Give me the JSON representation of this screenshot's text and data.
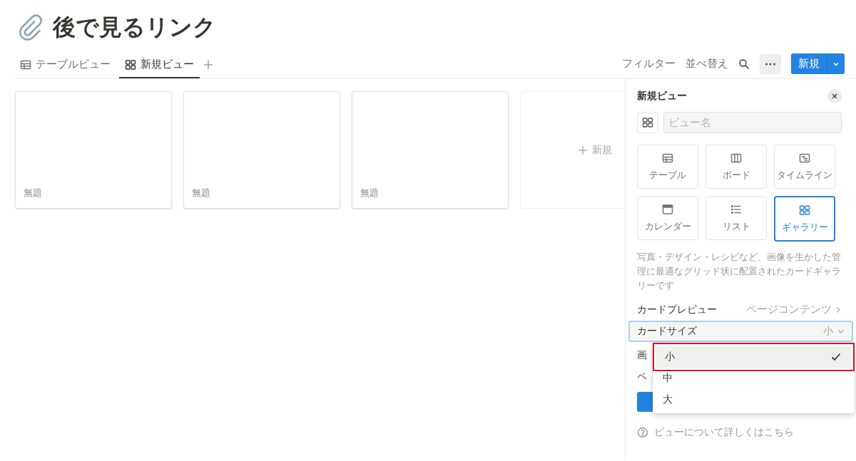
{
  "page": {
    "title": "後で見るリンク"
  },
  "tabs": [
    {
      "label": "テーブルビュー",
      "kind": "table",
      "selected": false
    },
    {
      "label": "新規ビュー",
      "kind": "gallery",
      "selected": true
    }
  ],
  "toolbar": {
    "filter": "フィルター",
    "sort": "並べ替え",
    "new_button": "新規"
  },
  "cards": [
    {
      "title": "無題"
    },
    {
      "title": "無題"
    },
    {
      "title": "無題"
    }
  ],
  "add_card": {
    "label": "新規"
  },
  "panel": {
    "title": "新規ビュー",
    "name_field": {
      "placeholder": "ビュー名"
    },
    "view_types": [
      {
        "kind": "table",
        "label": "テーブル",
        "selected": false
      },
      {
        "kind": "board",
        "label": "ボード",
        "selected": false
      },
      {
        "kind": "timeline",
        "label": "タイムライン",
        "selected": false
      },
      {
        "kind": "calendar",
        "label": "カレンダー",
        "selected": false
      },
      {
        "kind": "list",
        "label": "リスト",
        "selected": false
      },
      {
        "kind": "gallery",
        "label": "ギャラリー",
        "selected": true
      }
    ],
    "description": "写真・デザイン・レシピなど、画像を生かした管理に最適なグリッド状に配置されたカードギャラリーです",
    "card_preview": {
      "label": "カードプレビュー",
      "value": "ページコンテンツ"
    },
    "card_size": {
      "label": "カードサイズ",
      "value": "小",
      "expanded": true,
      "options": [
        {
          "label": "小",
          "selected": true,
          "highlighted": true
        },
        {
          "label": "中",
          "selected": false,
          "highlighted": false
        },
        {
          "label": "大",
          "selected": false,
          "highlighted": false
        }
      ]
    },
    "covered_rows": [
      "画",
      "ペ"
    ],
    "help_link": "ビューについて詳しくはこちら"
  }
}
